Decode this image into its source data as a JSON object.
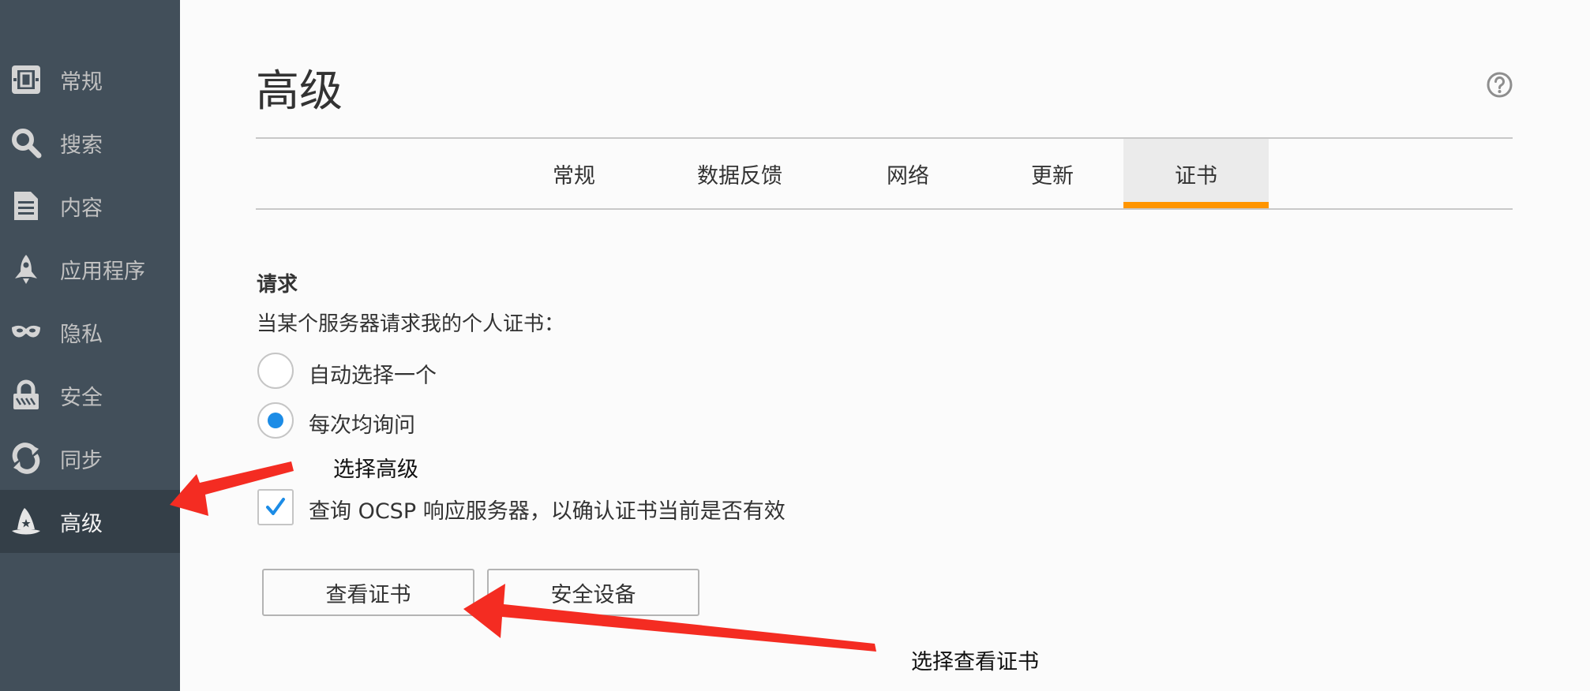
{
  "sidebar": {
    "items": [
      {
        "label": "常规",
        "icon": "general-icon"
      },
      {
        "label": "搜索",
        "icon": "search-icon"
      },
      {
        "label": "内容",
        "icon": "document-icon"
      },
      {
        "label": "应用程序",
        "icon": "rocket-icon"
      },
      {
        "label": "隐私",
        "icon": "mask-icon"
      },
      {
        "label": "安全",
        "icon": "lock-icon"
      },
      {
        "label": "同步",
        "icon": "sync-icon"
      },
      {
        "label": "高级",
        "icon": "wizard-hat-icon",
        "active": true
      }
    ]
  },
  "header": {
    "title": "高级"
  },
  "tabs": [
    {
      "label": "常规"
    },
    {
      "label": "数据反馈"
    },
    {
      "label": "网络"
    },
    {
      "label": "更新"
    },
    {
      "label": "证书",
      "active": true
    }
  ],
  "certificates": {
    "section_title": "请求",
    "description": "当某个服务器请求我的个人证书：",
    "options": [
      {
        "label": "自动选择一个",
        "checked": false
      },
      {
        "label": "每次均询问",
        "checked": true
      }
    ],
    "ocsp_label": "查询 OCSP 响应服务器，以确认证书当前是否有效",
    "ocsp_checked": true,
    "view_button": "查看证书",
    "devices_button": "安全设备"
  },
  "annotations": {
    "select_advanced": "选择高级",
    "select_view_certs": "选择查看证书"
  },
  "colors": {
    "sidebar_bg": "#424f5a",
    "sidebar_active_bg": "#343f48",
    "tab_accent": "#ff9500",
    "radio_accent": "#1c8ce6",
    "arrow": "#f42c22"
  }
}
